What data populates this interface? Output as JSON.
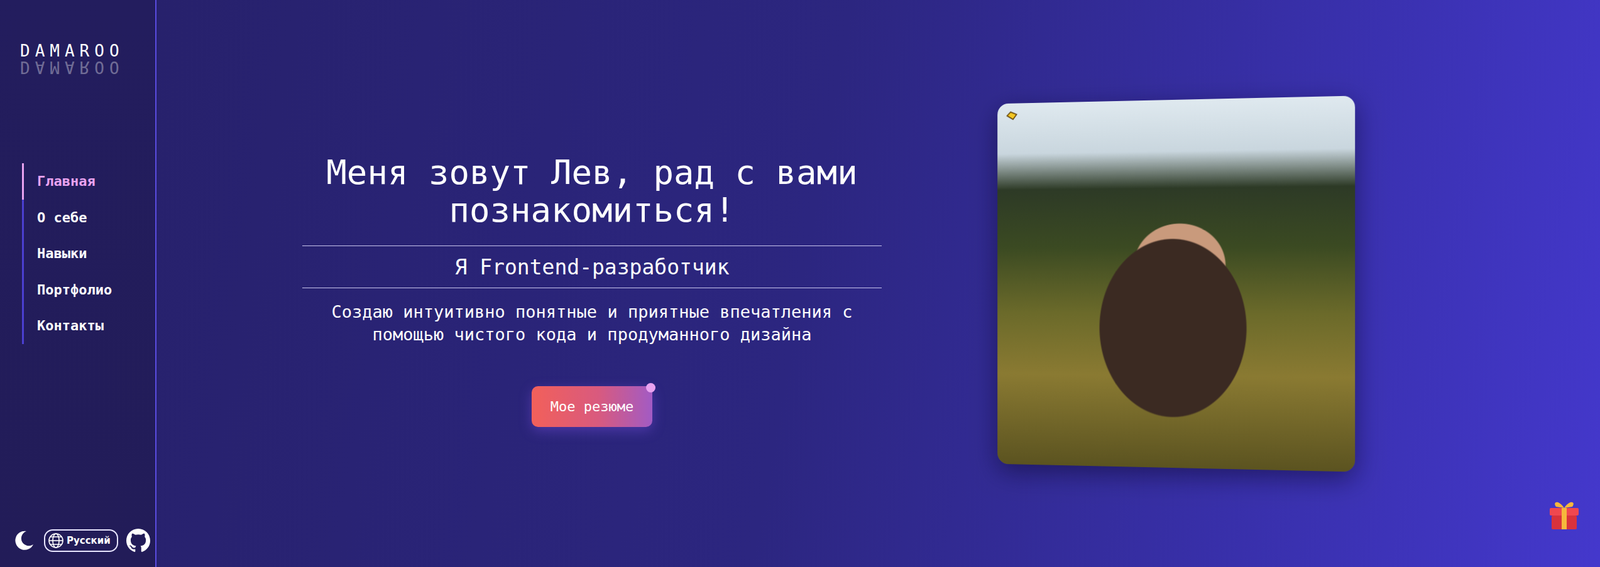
{
  "logo": "DAMAROO",
  "nav": [
    {
      "label": "Главная",
      "selected": true
    },
    {
      "label": "О себе",
      "selected": false
    },
    {
      "label": "Навыки",
      "selected": false
    },
    {
      "label": "Портфолио",
      "selected": false
    },
    {
      "label": "Контакты",
      "selected": false
    }
  ],
  "language": "Русский",
  "hero": {
    "title": "Меня зовут Лев, рад с вами познакомиться!",
    "subtitle": "Я Frontend-разработчик",
    "description": "Создаю интуитивно понятные и приятные впечатления с помощью чистого кода и продуманного дизайна",
    "button": "Мое резюме"
  }
}
